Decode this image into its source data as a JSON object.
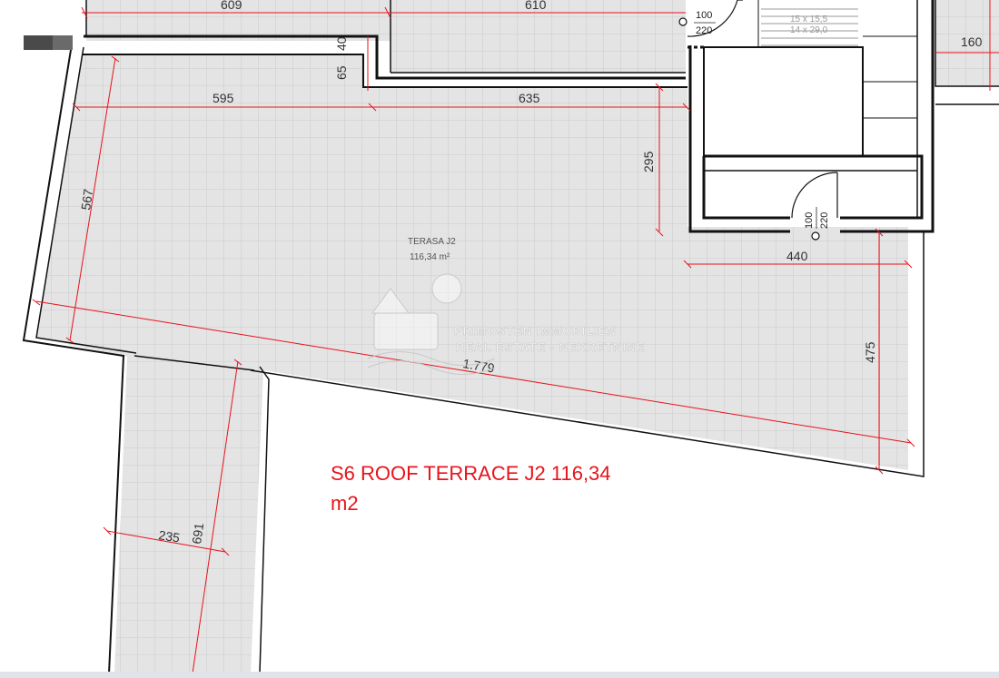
{
  "caption": "S6 ROOF TERRACE J2 116,34 m2",
  "room": {
    "name": "TERASA J2",
    "area": "116,34 m²"
  },
  "watermark": {
    "line1": "PRIMOSTEN IMMOBILIEN",
    "line2": "REAL ESTATE - NEKRETNINE"
  },
  "dimensions": {
    "top_left": "609",
    "top_mid": "610",
    "top_right": "160",
    "step_40": "40",
    "step_65": "65",
    "run_595": "595",
    "run_635": "635",
    "drop_295": "295",
    "side_567": "567",
    "width_440": "440",
    "side_475": "475",
    "diagonal": "1.779",
    "leg_235": "235",
    "leg_691": "691"
  },
  "doors": {
    "upper": {
      "width": "100",
      "height": "220"
    },
    "lower": {
      "width": "100",
      "height": "220"
    }
  },
  "stair": {
    "line1": "15 x 15,5",
    "line2": "14 x 29,0"
  },
  "colors": {
    "dimension_line": "#e8131b",
    "caption": "#e8131b",
    "floor": "#e4e4e4",
    "grid": "#c9c9c9",
    "wall": "#111111"
  }
}
